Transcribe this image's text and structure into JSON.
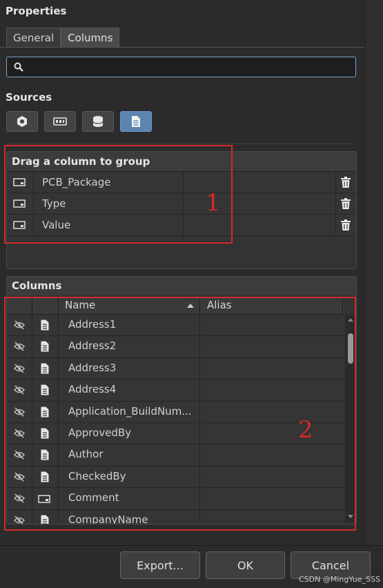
{
  "panel": {
    "title": "Properties"
  },
  "tabs": [
    {
      "label": "General"
    },
    {
      "label": "Columns"
    }
  ],
  "search": {
    "value": "",
    "placeholder": ""
  },
  "sources": {
    "label": "Sources",
    "buttons": [
      {
        "icon": "component-icon",
        "active": false
      },
      {
        "icon": "pcb-board-icon",
        "active": false
      },
      {
        "icon": "database-icon",
        "active": false
      },
      {
        "icon": "document-icon",
        "active": true
      }
    ]
  },
  "group_panel": {
    "header": "Drag a column to group",
    "rows": [
      {
        "label": "PCB_Package",
        "icon": "parameter-icon"
      },
      {
        "label": "Type",
        "icon": "parameter-icon"
      },
      {
        "label": "Value",
        "icon": "parameter-icon"
      }
    ]
  },
  "columns_panel": {
    "header": "Columns",
    "table_headers": {
      "name": "Name",
      "alias": "Alias"
    },
    "rows": [
      {
        "name": "Address1",
        "alias": "",
        "source": "document-icon"
      },
      {
        "name": "Address2",
        "alias": "",
        "source": "document-icon"
      },
      {
        "name": "Address3",
        "alias": "",
        "source": "document-icon"
      },
      {
        "name": "Address4",
        "alias": "",
        "source": "document-icon"
      },
      {
        "name": "Application_BuildNum...",
        "alias": "",
        "source": "document-icon"
      },
      {
        "name": "ApprovedBy",
        "alias": "",
        "source": "document-icon"
      },
      {
        "name": "Author",
        "alias": "",
        "source": "document-icon"
      },
      {
        "name": "CheckedBy",
        "alias": "",
        "source": "document-icon"
      },
      {
        "name": "Comment",
        "alias": "",
        "source": "parameter-icon"
      },
      {
        "name": "CompanyName",
        "alias": "",
        "source": "document-icon"
      }
    ]
  },
  "annotations": {
    "label1": "1",
    "label2": "2",
    "color": "#d42a2a"
  },
  "footer": {
    "export_label": "Export...",
    "ok_label": "OK",
    "cancel_label": "Cancel"
  },
  "watermark": "CSDN @MingYue_SSS",
  "colors": {
    "accent": "#5b84b1",
    "search_border": "#7aa6cc",
    "background": "#2b2b2b"
  }
}
